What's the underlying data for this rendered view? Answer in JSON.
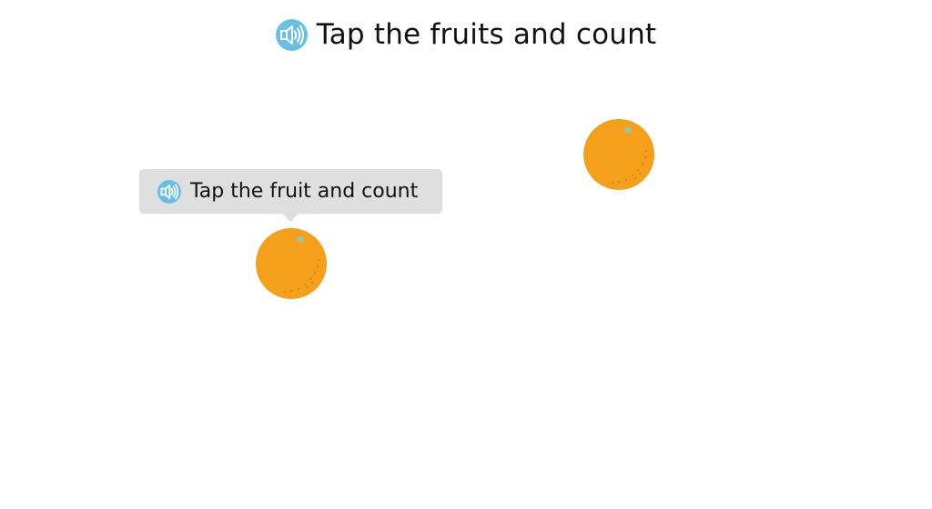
{
  "header": {
    "title": "Tap the fruits and count",
    "audio_icon": "speaker-icon"
  },
  "tooltip": {
    "text": "Tap the fruit and count",
    "audio_icon": "speaker-icon"
  },
  "fruits": [
    {
      "kind": "orange",
      "icon": "orange-icon"
    },
    {
      "kind": "orange",
      "icon": "orange-icon"
    }
  ],
  "colors": {
    "speaker_bg": "#69c0e2",
    "tooltip_bg": "#dfdfdf",
    "orange": "#f5a01b",
    "leaf": "#8fc9a8"
  }
}
